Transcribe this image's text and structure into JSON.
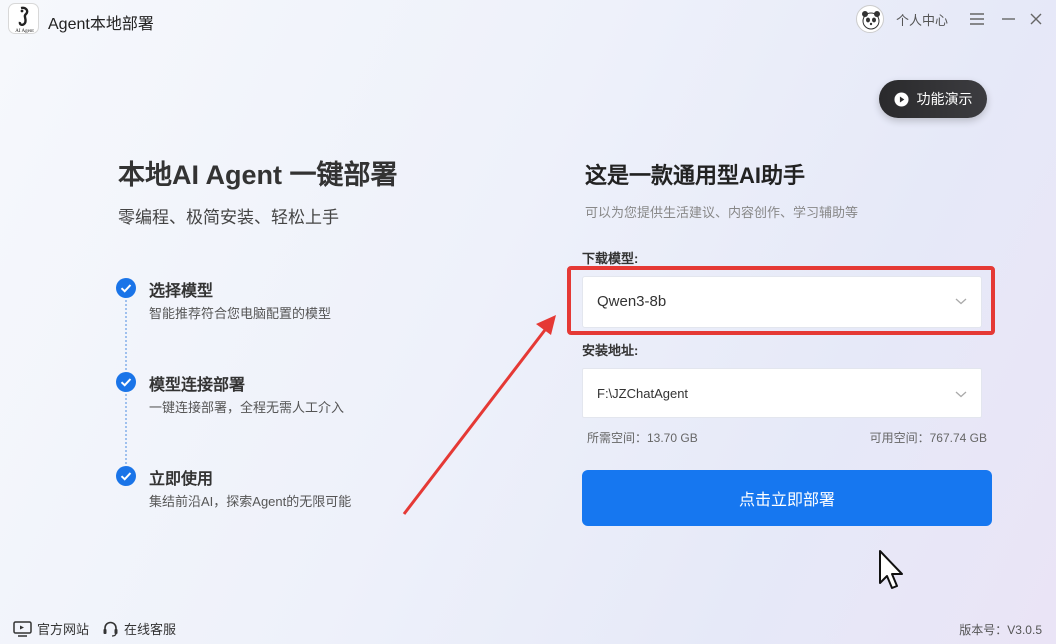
{
  "app": {
    "title": "Agent本地部署",
    "logo_text": "AI Agent"
  },
  "header": {
    "user_label": "个人中心",
    "menu_icon": "hamburger-menu-icon",
    "minimize_icon": "minimize-icon",
    "close_icon": "close-icon"
  },
  "demo_button": {
    "label": "功能演示",
    "icon": "play-circle-icon"
  },
  "left": {
    "title": "本地AI Agent 一键部署",
    "subtitle": "零编程、极简安装、轻松上手",
    "steps": [
      {
        "title": "选择模型",
        "desc": "智能推荐符合您电脑配置的模型"
      },
      {
        "title": "模型连接部署",
        "desc": "一键连接部署，全程无需人工介入"
      },
      {
        "title": "立即使用",
        "desc": "集结前沿AI，探索Agent的无限可能"
      }
    ]
  },
  "right": {
    "title": "这是一款通用型AI助手",
    "subtitle": "可以为您提供生活建议、内容创作、学习辅助等",
    "model_label": "下载模型:",
    "model_value": "Qwen3-8b",
    "path_label": "安装地址:",
    "path_value": "F:\\JZChatAgent",
    "space_needed": "所需空间：13.70 GB",
    "space_available": "可用空间：767.74 GB",
    "deploy_label": "点击立即部署"
  },
  "footer": {
    "website_label": "官方网站",
    "service_label": "在线客服",
    "version": "版本号：V3.0.5"
  },
  "colors": {
    "accent": "#1677f0",
    "annotation": "#e53935",
    "check": "#1a74e8"
  }
}
